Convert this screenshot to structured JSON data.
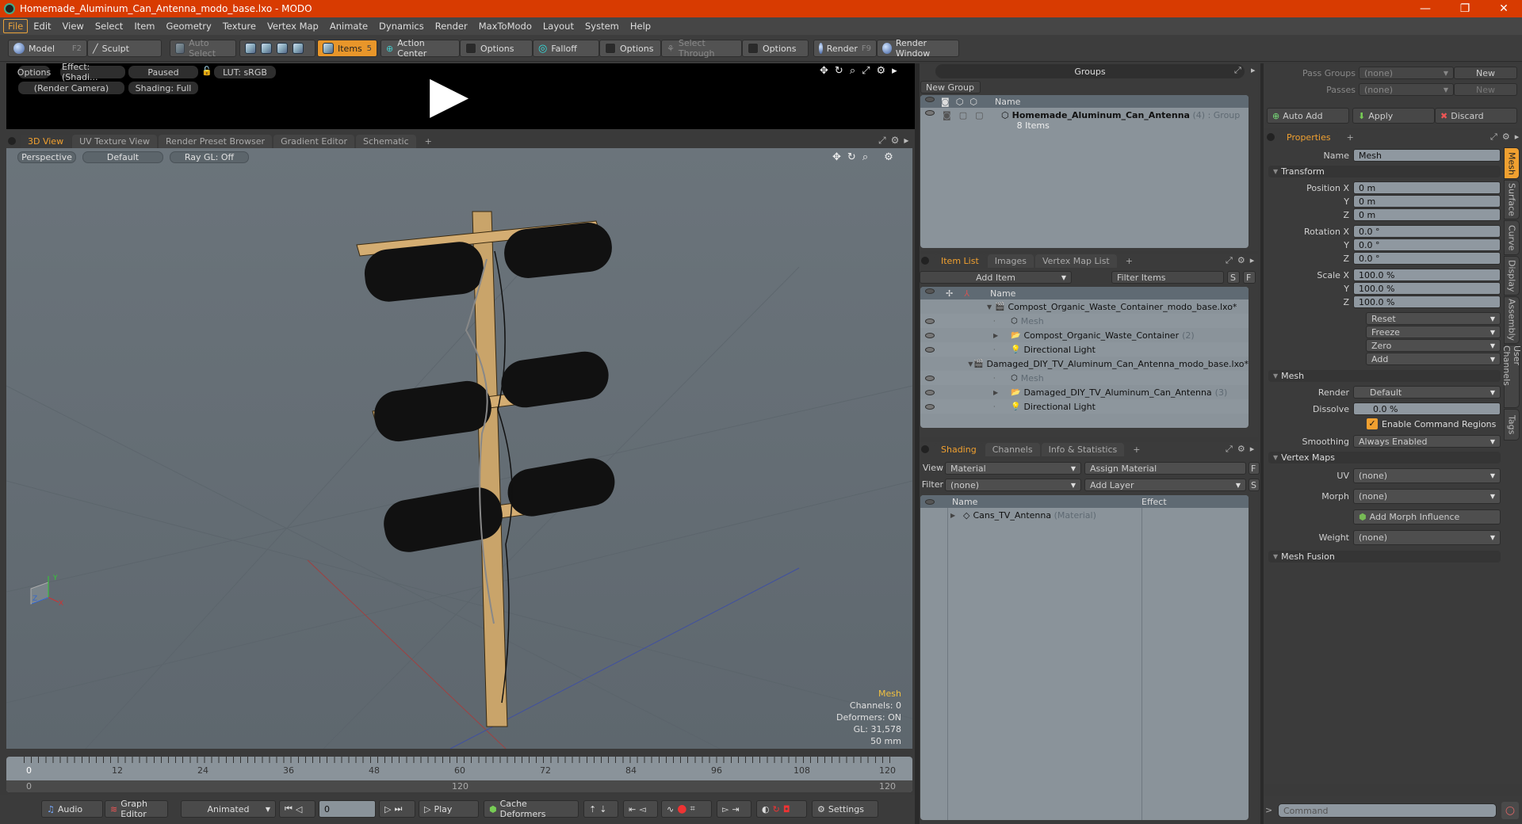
{
  "window": {
    "title": "Homemade_Aluminum_Can_Antenna_modo_base.lxo - MODO",
    "minimize": "—",
    "restore": "❐",
    "close": "✕"
  },
  "menu": [
    "File",
    "Edit",
    "View",
    "Select",
    "Item",
    "Geometry",
    "Texture",
    "Vertex Map",
    "Animate",
    "Dynamics",
    "Render",
    "MaxToModo",
    "Layout",
    "System",
    "Help"
  ],
  "toolbar": {
    "model": "Model",
    "model_key": "F2",
    "sculpt": "Sculpt",
    "auto_select": "Auto Select",
    "items": "Items",
    "items_key": "5",
    "action_center": "Action Center",
    "options1": "Options",
    "falloff": "Falloff",
    "options2": "Options",
    "select_through": "Select Through",
    "options3": "Options",
    "render": "Render",
    "render_key": "F9",
    "render_window": "Render Window"
  },
  "preview": {
    "options": "Options",
    "effect": "Effect: (Shadi...",
    "paused": "Paused",
    "lut": "LUT: sRGB",
    "camera": "(Render Camera)",
    "shading": "Shading: Full",
    "play_icon": "▶"
  },
  "viewport_tabs": [
    "3D View",
    "UV Texture View",
    "Render Preset Browser",
    "Gradient Editor",
    "Schematic",
    "+"
  ],
  "viewport": {
    "projection": "Perspective",
    "style": "Default",
    "raygl": "Ray GL: Off",
    "info": {
      "selection": "Mesh",
      "channels": "Channels: 0",
      "deformers": "Deformers: ON",
      "gl": "GL: 31,578",
      "focal": "50 mm"
    },
    "axis": {
      "x": "X",
      "y": "Y",
      "z": "Z"
    }
  },
  "timeline": {
    "ticks": [
      "0",
      "12",
      "24",
      "36",
      "48",
      "60",
      "72",
      "84",
      "96",
      "108",
      "120"
    ],
    "range_start": "0",
    "range_end": "120",
    "range_mid": "120"
  },
  "transport": {
    "audio": "Audio",
    "graph_editor": "Graph Editor",
    "mode": "Animated",
    "frame": "0",
    "play": "Play",
    "cache": "Cache Deformers",
    "settings": "Settings"
  },
  "groups": {
    "title": "Groups",
    "new_group": "New Group",
    "col_name": "Name",
    "row": {
      "name": "Homemade_Aluminum_Can_Antenna",
      "count": "(4)",
      "type": ": Group",
      "sub": "8 Items"
    }
  },
  "item_list": {
    "tabs": [
      "Item List",
      "Images",
      "Vertex Map List",
      "+"
    ],
    "add_item": "Add Item",
    "filter": "Filter Items",
    "s": "S",
    "f": "F",
    "col_name": "Name",
    "rows": [
      {
        "name": "Compost_Organic_Waste_Container_modo_base.lxo*",
        "level": 0,
        "kind": "scene"
      },
      {
        "name": "Mesh",
        "level": 1,
        "kind": "mesh"
      },
      {
        "name": "Compost_Organic_Waste_Container",
        "count": "(2)",
        "level": 1,
        "kind": "group"
      },
      {
        "name": "Directional Light",
        "level": 1,
        "kind": "light"
      },
      {
        "name": "Damaged_DIY_TV_Aluminum_Can_Antenna_modo_base.lxo*",
        "level": 0,
        "kind": "scene"
      },
      {
        "name": "Mesh",
        "level": 1,
        "kind": "mesh"
      },
      {
        "name": "Damaged_DIY_TV_Aluminum_Can_Antenna",
        "count": "(3)",
        "level": 1,
        "kind": "group"
      },
      {
        "name": "Directional Light",
        "level": 1,
        "kind": "light"
      }
    ]
  },
  "shading": {
    "tabs": [
      "Shading",
      "Channels",
      "Info & Statistics",
      "+"
    ],
    "view_label": "View",
    "view_value": "Material",
    "assign": "Assign Material",
    "f": "F",
    "filter_label": "Filter",
    "filter_value": "(none)",
    "add_layer": "Add Layer",
    "s": "S",
    "col_name": "Name",
    "col_effect": "Effect",
    "row": {
      "name": "Cans_TV_Antenna",
      "type": "(Material)"
    }
  },
  "passes": {
    "pass_groups_label": "Pass Groups",
    "pass_groups_value": "(none)",
    "passes_label": "Passes",
    "passes_value": "(none)",
    "new": "New",
    "auto_add": "Auto Add",
    "apply": "Apply",
    "discard": "Discard"
  },
  "properties": {
    "tab": "Properties",
    "name_label": "Name",
    "name_value": "Mesh",
    "transform": "Transform",
    "position": {
      "label": "Position X",
      "x": "0 m",
      "y": "0 m",
      "z": "0 m"
    },
    "rotation": {
      "label": "Rotation X",
      "x": "0.0 °",
      "y": "0.0 °",
      "z": "0.0 °"
    },
    "scale": {
      "label": "Scale X",
      "x": "100.0 %",
      "y": "100.0 %",
      "z": "100.0 %"
    },
    "axis_y": "Y",
    "axis_z": "Z",
    "actions": [
      "Reset",
      "Freeze",
      "Zero",
      "Add"
    ],
    "mesh": "Mesh",
    "render_label": "Render",
    "render_value": "Default",
    "dissolve_label": "Dissolve",
    "dissolve_value": "0.0 %",
    "command_regions": "Enable Command Regions",
    "smoothing_label": "Smoothing",
    "smoothing_value": "Always Enabled",
    "vertex_maps": "Vertex Maps",
    "uv_label": "UV",
    "uv_value": "(none)",
    "morph_label": "Morph",
    "morph_value": "(none)",
    "add_morph": "Add Morph Influence",
    "weight_label": "Weight",
    "weight_value": "(none)",
    "mesh_fusion": "Mesh Fusion",
    "side_tabs": [
      "Mesh",
      "Surface",
      "Curve",
      "Display",
      "Assembly",
      "User Channels",
      "Tags"
    ]
  },
  "command": {
    "prompt": ">",
    "placeholder": "Command"
  }
}
